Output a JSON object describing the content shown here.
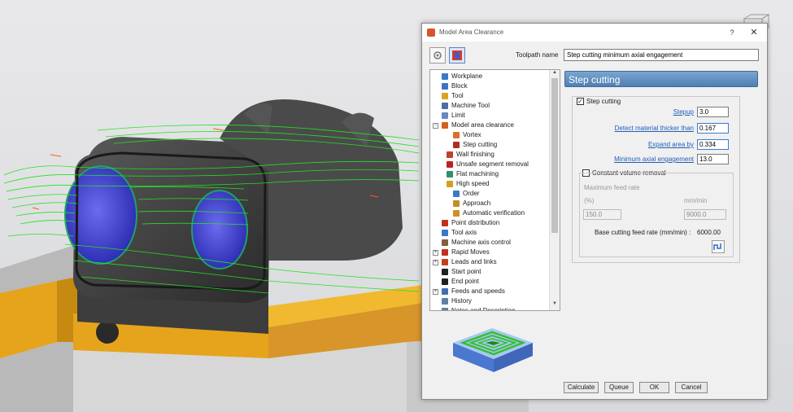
{
  "dialog": {
    "title": "Model Area Clearance",
    "help": "?",
    "close": "✕"
  },
  "toolpath": {
    "label": "Toolpath name",
    "value": "Step cutting minimum axial engagement"
  },
  "tree": {
    "items": [
      {
        "label": "Workplane",
        "icon_color": "#3a78c8"
      },
      {
        "label": "Block",
        "icon_color": "#3c74c4"
      },
      {
        "label": "Tool",
        "icon_color": "#d9a520"
      },
      {
        "label": "Machine Tool",
        "icon_color": "#4a6fa0"
      },
      {
        "label": "Limit",
        "icon_color": "#6a8ab8"
      },
      {
        "label": "Model area clearance",
        "icon_color": "#d06020"
      },
      {
        "label": "Vortex",
        "icon_color": "#d87030"
      },
      {
        "label": "Step cutting",
        "icon_color": "#b03020"
      },
      {
        "label": "Wall finishing",
        "icon_color": "#c04030"
      },
      {
        "label": "Unsafe segment removal",
        "icon_color": "#c02020"
      },
      {
        "label": "Flat machining",
        "icon_color": "#2f8f6f"
      },
      {
        "label": "High speed",
        "icon_color": "#d0a020"
      },
      {
        "label": "Order",
        "icon_color": "#3a78c8"
      },
      {
        "label": "Approach",
        "icon_color": "#c09020"
      },
      {
        "label": "Automatic verification",
        "icon_color": "#d09020"
      },
      {
        "label": "Point distribution",
        "icon_color": "#c03020"
      },
      {
        "label": "Tool axis",
        "icon_color": "#3a78c8"
      },
      {
        "label": "Machine axis control",
        "icon_color": "#806040"
      },
      {
        "label": "Rapid Moves",
        "icon_color": "#c03020"
      },
      {
        "label": "Leads and links",
        "icon_color": "#c04020"
      },
      {
        "label": "Start point",
        "icon_color": "#202020"
      },
      {
        "label": "End point",
        "icon_color": "#202020"
      },
      {
        "label": "Feeds and speeds",
        "icon_color": "#4070b0"
      },
      {
        "label": "History",
        "icon_color": "#6080a0"
      },
      {
        "label": "Notes and Description",
        "icon_color": "#6080a0"
      }
    ]
  },
  "page": {
    "title": "Step cutting",
    "step_cutting_checkbox": "Step cutting",
    "stepup_label": "Stepup",
    "stepup_value": "3.0",
    "detect_label": "Detect material thicker than",
    "detect_value": "0.167",
    "expand_label": "Expand area by",
    "expand_value": "0.334",
    "min_axial_label": "Minimum axial engagement",
    "min_axial_value": "13.0",
    "constant_volume_label": "Constant volume removal",
    "max_feed_rate_label": "Maximum feed rate",
    "percent_label": "(%)",
    "mmmin_label": "mm/min",
    "percent_value": "150.0",
    "mmmin_value": "9000.0",
    "base_feed_label": "Base cutting feed rate (mm/min) :",
    "base_feed_value": "6000.00"
  },
  "buttons": {
    "calculate": "Calculate",
    "queue": "Queue",
    "ok": "OK",
    "cancel": "Cancel"
  },
  "colors": {
    "toolpath_green": "#22e022",
    "model_dark": "#3a3a3a",
    "vice_yellow": "#e6a41c",
    "accent_blue": "#5a86bd"
  }
}
